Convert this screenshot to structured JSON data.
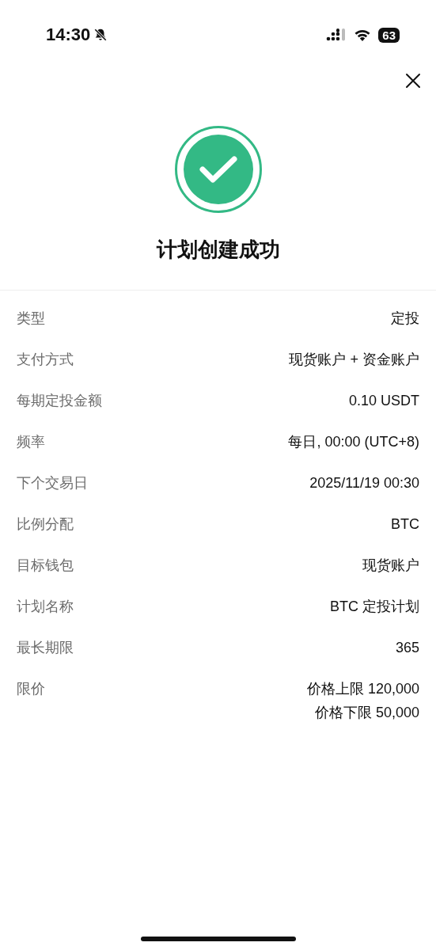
{
  "status_bar": {
    "time": "14:30",
    "battery": "63"
  },
  "title": "计划创建成功",
  "details": [
    {
      "label": "类型",
      "values": [
        "定投"
      ]
    },
    {
      "label": "支付方式",
      "values": [
        "现货账户 + 资金账户"
      ]
    },
    {
      "label": "每期定投金额",
      "values": [
        "0.10 USDT"
      ]
    },
    {
      "label": "频率",
      "values": [
        "每日, 00:00 (UTC+8)"
      ]
    },
    {
      "label": "下个交易日",
      "values": [
        "2025/11/19 00:30"
      ]
    },
    {
      "label": "比例分配",
      "values": [
        "BTC"
      ]
    },
    {
      "label": "目标钱包",
      "values": [
        "现货账户"
      ]
    },
    {
      "label": "计划名称",
      "values": [
        "BTC 定投计划"
      ]
    },
    {
      "label": "最长期限",
      "values": [
        "365"
      ]
    },
    {
      "label": "限价",
      "values": [
        "价格上限 120,000",
        "价格下限 50,000"
      ]
    }
  ]
}
